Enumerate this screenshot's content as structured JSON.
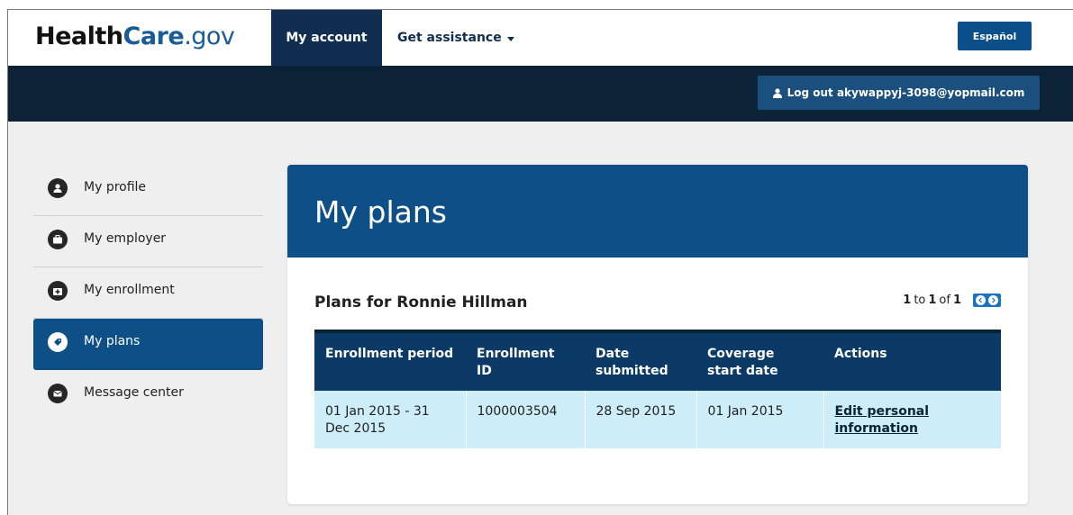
{
  "header": {
    "logo": {
      "part1": "Health",
      "part2": "Care",
      "part3": ".gov"
    },
    "nav": {
      "my_account": "My account",
      "get_assistance": "Get assistance"
    },
    "espanol": "Español",
    "logout": "Log out akywappyj-3098@yopmail.com"
  },
  "sidebar": {
    "items": [
      {
        "label": "My profile",
        "icon": "user-icon",
        "active": false
      },
      {
        "label": "My employer",
        "icon": "briefcase-icon",
        "active": false
      },
      {
        "label": "My enrollment",
        "icon": "medical-kit-icon",
        "active": false
      },
      {
        "label": "My plans",
        "icon": "tag-icon",
        "active": true
      },
      {
        "label": "Message center",
        "icon": "envelope-icon",
        "active": false
      }
    ]
  },
  "main": {
    "title": "My plans",
    "plans_heading": "Plans for Ronnie Hillman",
    "pager": {
      "from": "1",
      "to_word": "to",
      "to": "1",
      "of_word": "of",
      "total": "1"
    },
    "table": {
      "headers": [
        "Enrollment period",
        "Enrollment ID",
        "Date submitted",
        "Coverage start date",
        "Actions"
      ],
      "rows": [
        {
          "period": "01 Jan 2015 - 31 Dec 2015",
          "id": "1000003504",
          "submitted": "28 Sep 2015",
          "start": "01 Jan 2015",
          "action": "Edit personal information"
        }
      ]
    }
  },
  "colors": {
    "brand_blue": "#0e4f87",
    "dark_navy": "#0b2237",
    "row_highlight": "#cdeef9"
  }
}
